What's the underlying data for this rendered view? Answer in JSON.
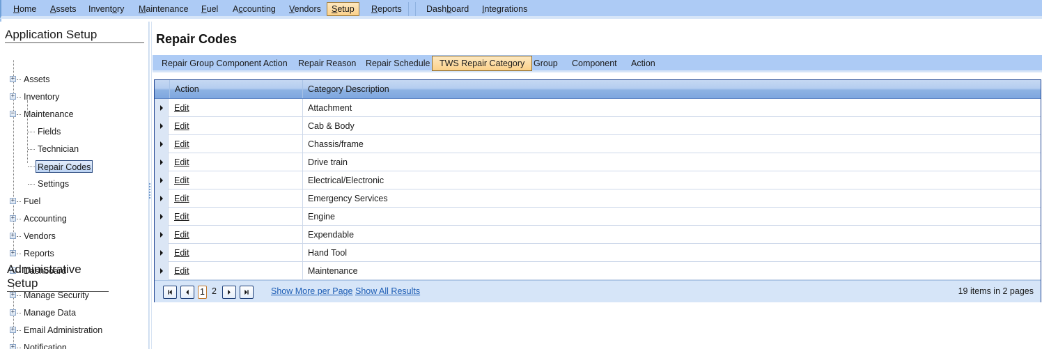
{
  "menu": {
    "items": [
      {
        "label": "Home",
        "accel": "H",
        "rest": "ome"
      },
      {
        "label": "Assets",
        "accel": "A",
        "rest": "ssets"
      },
      {
        "label": "Inventory",
        "pre": "Invent",
        "accel": "o",
        "rest": "ry"
      },
      {
        "label": "Maintenance",
        "accel": "M",
        "rest": "aintenance"
      },
      {
        "label": "Fuel",
        "accel": "F",
        "rest": "uel"
      },
      {
        "label": "Accounting",
        "pre": "A",
        "accel": "c",
        "rest": "counting"
      },
      {
        "label": "Vendors",
        "accel": "V",
        "rest": "endors"
      },
      {
        "label": "Setup",
        "accel": "S",
        "rest": "etup",
        "active": true
      },
      {
        "label": "Reports",
        "accel": "R",
        "rest": "eports"
      },
      {
        "label": "Dashboard",
        "pre": "Dash",
        "accel": "b",
        "rest": "oard"
      },
      {
        "label": "Integrations",
        "accel": "I",
        "rest": "ntegrations"
      }
    ]
  },
  "sidebar": {
    "app_setup_title": "Application Setup",
    "app_items": [
      {
        "label": "Assets",
        "expander": "+"
      },
      {
        "label": "Inventory",
        "expander": "+"
      },
      {
        "label": "Maintenance",
        "expander": "−"
      },
      {
        "label": "Fields",
        "child": true
      },
      {
        "label": "Technician",
        "child": true
      },
      {
        "label": "Repair Codes",
        "child": true,
        "selected": true
      },
      {
        "label": "Settings",
        "child": true
      },
      {
        "label": "Fuel",
        "expander": "+"
      },
      {
        "label": "Accounting",
        "expander": "+"
      },
      {
        "label": "Vendors",
        "expander": "+"
      },
      {
        "label": "Reports",
        "expander": "+"
      },
      {
        "label": "Dashboard",
        "expander": "+"
      }
    ],
    "admin_setup_title": "Administrative Setup",
    "admin_items": [
      {
        "label": "Manage Security",
        "expander": "+"
      },
      {
        "label": "Manage Data",
        "expander": "+"
      },
      {
        "label": "Email Administration",
        "expander": "+"
      },
      {
        "label": "Notification",
        "expander": "+"
      }
    ]
  },
  "main": {
    "title": "Repair Codes",
    "tabs": [
      {
        "label": "Repair Group Component Action"
      },
      {
        "label": "Repair Reason"
      },
      {
        "label": "Repair Schedule"
      },
      {
        "label": "TWS Repair Category",
        "active": true
      },
      {
        "label": "Group"
      },
      {
        "label": "Component"
      },
      {
        "label": "Action"
      }
    ],
    "grid": {
      "columns": [
        "Action",
        "Category Description"
      ],
      "rows": [
        {
          "action": "Edit",
          "description": "Attachment"
        },
        {
          "action": "Edit",
          "description": "Cab & Body"
        },
        {
          "action": "Edit",
          "description": "Chassis/frame"
        },
        {
          "action": "Edit",
          "description": "Drive train"
        },
        {
          "action": "Edit",
          "description": "Electrical/Electronic"
        },
        {
          "action": "Edit",
          "description": "Emergency Services"
        },
        {
          "action": "Edit",
          "description": "Engine"
        },
        {
          "action": "Edit",
          "description": "Expendable"
        },
        {
          "action": "Edit",
          "description": "Hand Tool"
        },
        {
          "action": "Edit",
          "description": "Maintenance"
        }
      ]
    },
    "pager": {
      "pages": [
        "1",
        "2"
      ],
      "current_page": "1",
      "show_more_label": "Show More per Page",
      "show_all_label": "Show All Results",
      "summary": "19 items in 2 pages"
    }
  }
}
